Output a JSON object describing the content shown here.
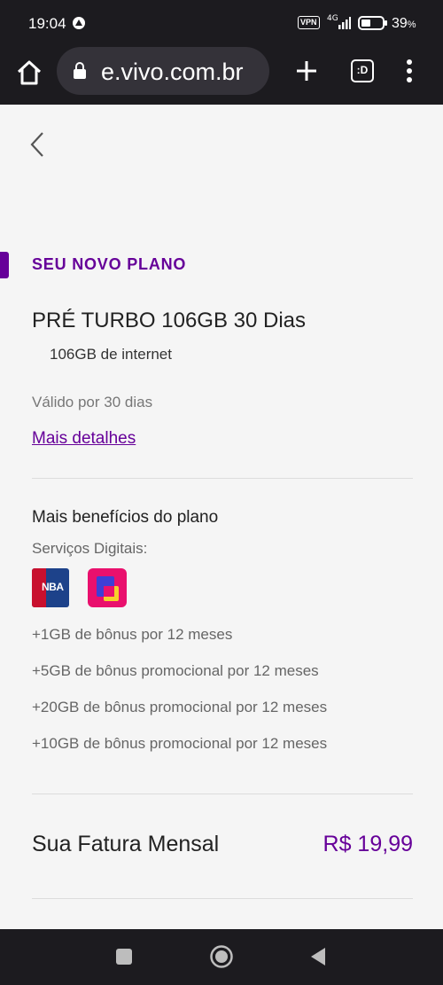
{
  "status_bar": {
    "time": "19:04",
    "vpn": "VPN",
    "network": "4G",
    "battery": "39",
    "battery_unit": "%"
  },
  "browser": {
    "url": "e.vivo.com.br",
    "tabs_label": ":D"
  },
  "plan": {
    "section_title": "SEU NOVO PLANO",
    "name": "PRÉ TURBO 106GB 30 Dias",
    "internet": "106GB de internet",
    "validity": "Válido por 30 dias",
    "details_link": "Mais detalhes"
  },
  "benefits": {
    "title": "Mais benefícios do plano",
    "services_label": "Serviços Digitais:",
    "nba_logo_text": "NBA",
    "items": [
      "+1GB de bônus por 12 meses",
      "+5GB de bônus promocional por 12 meses",
      "+20GB de bônus promocional por 12 meses",
      "+10GB de bônus promocional por 12 meses"
    ]
  },
  "invoice": {
    "label": "Sua Fatura Mensal",
    "value": "R$ 19,99"
  },
  "colors": {
    "brand_purple": "#660099",
    "dark_bar": "#1c1b1f"
  }
}
